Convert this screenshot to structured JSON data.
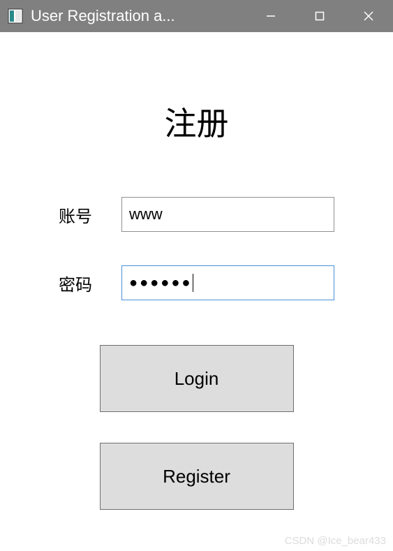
{
  "titlebar": {
    "title": "User Registration a..."
  },
  "page": {
    "heading": "注册"
  },
  "form": {
    "username": {
      "label": "账号",
      "value": "www"
    },
    "password": {
      "label": "密码",
      "masked_value": "●●●●●●"
    }
  },
  "buttons": {
    "login": "Login",
    "register": "Register"
  },
  "watermark": "CSDN @Ice_bear433"
}
